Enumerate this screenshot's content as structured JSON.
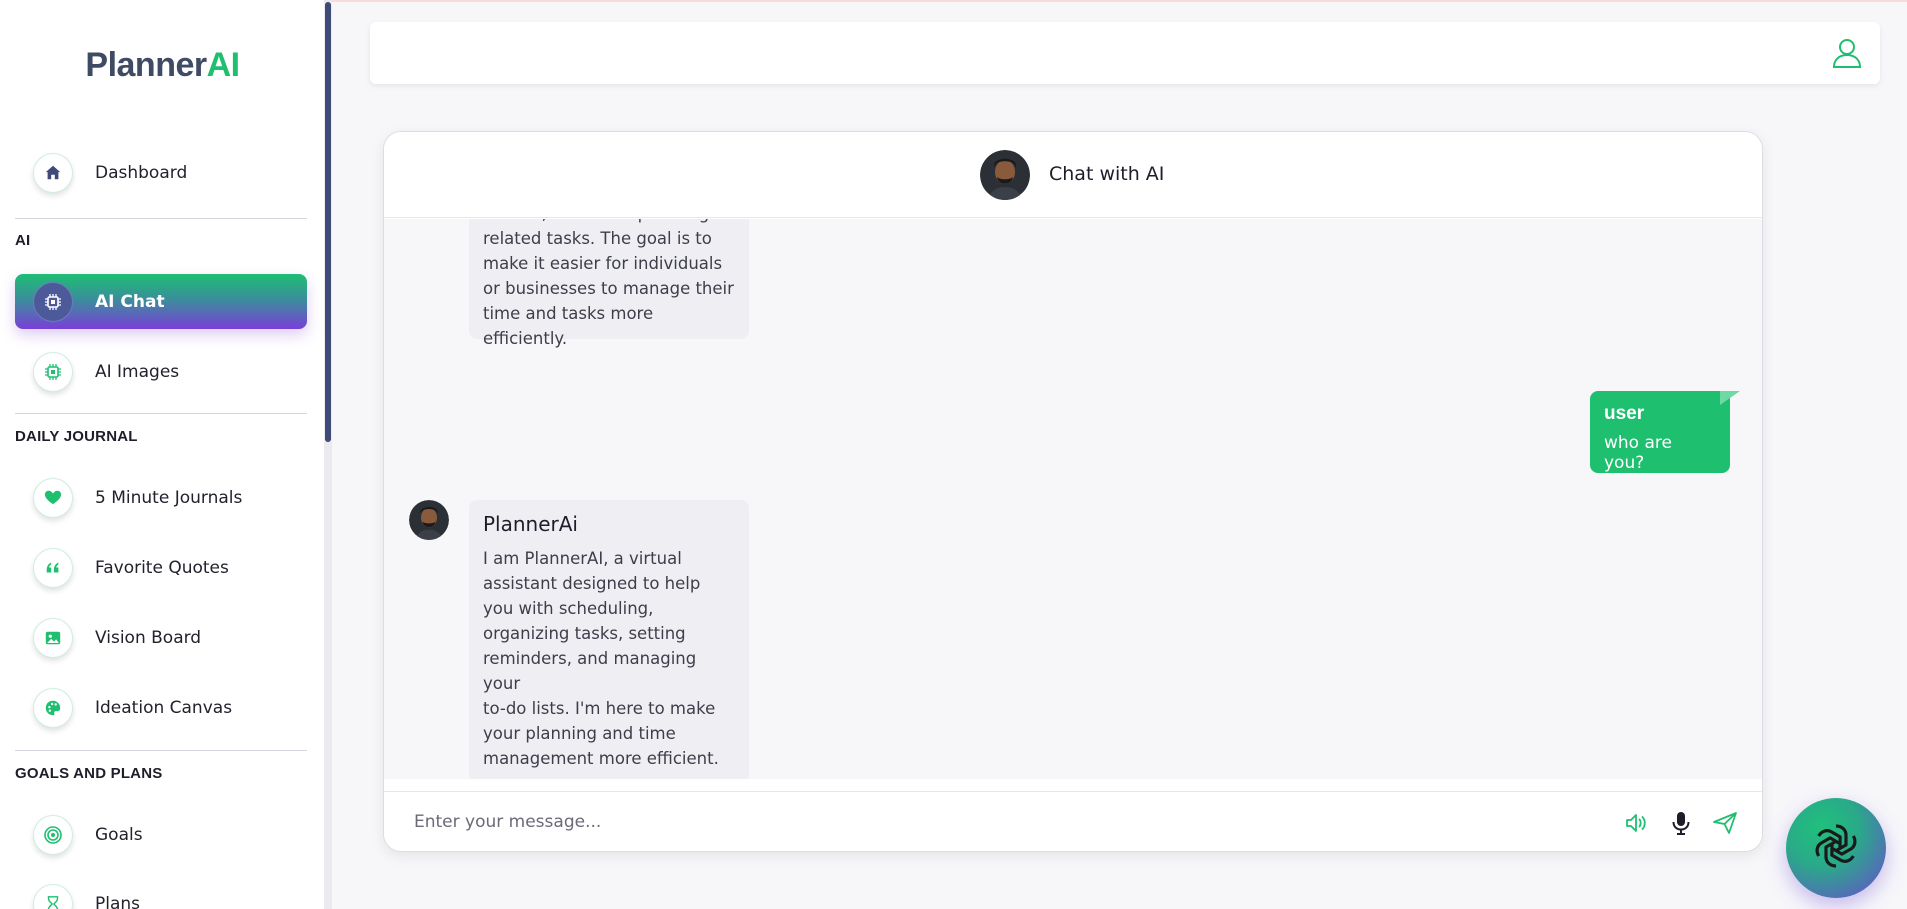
{
  "brand": {
    "part1": "Planner",
    "part2": "AI"
  },
  "sidebar": {
    "dashboard": "Dashboard",
    "sections": {
      "ai": "AI",
      "daily_journal": "DAILY JOURNAL",
      "goals_and_plans": "GOALS AND PLANS"
    },
    "items": {
      "ai_chat": "AI Chat",
      "ai_images": "AI Images",
      "five_minute_journals": "5 Minute Journals",
      "favorite_quotes": "Favorite Quotes",
      "vision_board": "Vision Board",
      "ideation_canvas": "Ideation Canvas",
      "goals": "Goals",
      "plans": "Plans"
    }
  },
  "chat": {
    "title": "Chat with AI",
    "messages": [
      {
        "sender": "ai",
        "text": "do lists, and other planning-\nrelated tasks. The goal is to\nmake it easier for individuals\nor businesses to manage their\ntime and tasks more\nefficiently."
      },
      {
        "sender": "user",
        "name": "user",
        "text": "who are you?"
      },
      {
        "sender": "ai",
        "name": "PlannerAi",
        "text": "I am PlannerAI, a virtual\nassistant designed to help\nyou with scheduling,\norganizing tasks, setting\nreminders, and managing your\nto-do lists. I'm here to make\nyour planning and time\nmanagement more efficient."
      }
    ],
    "input": {
      "placeholder": "Enter your message..."
    }
  },
  "colors": {
    "accent": "#1fbf70",
    "accent_purple": "#7a3fd8",
    "nav_dark": "#3f4a77"
  },
  "icons": {
    "dashboard": "home-icon",
    "ai_chat": "chip-icon",
    "ai_images": "chip-icon",
    "journals": "heart-icon",
    "quotes": "quote-icon",
    "vision": "image-icon",
    "ideation": "palette-icon",
    "goals": "target-icon",
    "plans": "hourglass-icon",
    "user": "user-icon",
    "speaker": "speaker-icon",
    "mic": "mic-icon",
    "send": "send-icon",
    "fab": "openai-icon"
  }
}
